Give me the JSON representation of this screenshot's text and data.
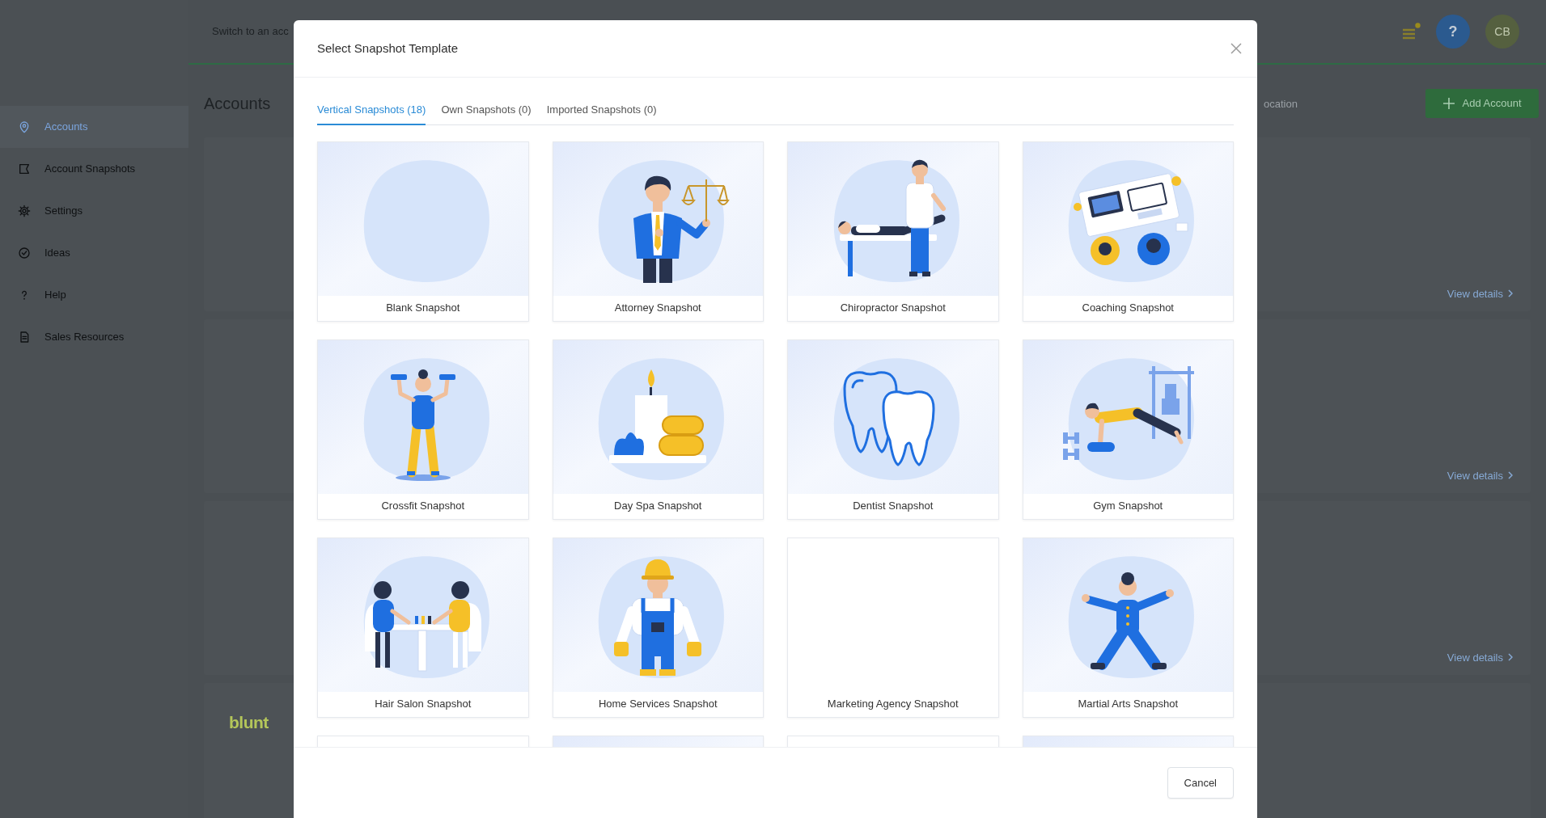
{
  "sidebar": {
    "items": [
      {
        "label": "Accounts",
        "selected": true
      },
      {
        "label": "Account Snapshots",
        "selected": false
      },
      {
        "label": "Settings",
        "selected": false
      },
      {
        "label": "Ideas",
        "selected": false
      },
      {
        "label": "Help",
        "selected": false
      },
      {
        "label": "Sales Resources",
        "selected": false
      }
    ]
  },
  "top_bar": {
    "switch_account_text": "Switch to an acc",
    "help_button": "?",
    "avatar": "CB"
  },
  "page": {
    "title": "Accounts",
    "search": {
      "placeholder": "ocation"
    },
    "add_button": "Add Account",
    "accounts": [
      {
        "link": "View details"
      },
      {
        "link": "View details"
      },
      {
        "link": "View details"
      },
      {
        "logo": "blunt"
      }
    ]
  },
  "modal": {
    "title": "Select Snapshot Template",
    "tabs": [
      {
        "label": "Vertical Snapshots (18)",
        "selected": true
      },
      {
        "label": "Own Snapshots (0)",
        "selected": false
      },
      {
        "label": "Imported Snapshots (0)",
        "selected": false
      }
    ],
    "templates": [
      {
        "label": "Blank Snapshot",
        "has_preview": true
      },
      {
        "label": "Attorney Snapshot",
        "has_preview": true
      },
      {
        "label": "Chiropractor Snapshot",
        "has_preview": true
      },
      {
        "label": "Coaching Snapshot",
        "has_preview": true
      },
      {
        "label": "Crossfit Snapshot",
        "has_preview": true
      },
      {
        "label": "Day Spa Snapshot",
        "has_preview": true
      },
      {
        "label": "Dentist Snapshot",
        "has_preview": true
      },
      {
        "label": "Gym Snapshot",
        "has_preview": true
      },
      {
        "label": "Hair Salon Snapshot",
        "has_preview": true
      },
      {
        "label": "Home Services Snapshot",
        "has_preview": true
      },
      {
        "label": "Marketing Agency Snapshot",
        "has_preview": false
      },
      {
        "label": "Martial Arts Snapshot",
        "has_preview": true
      },
      {
        "has_preview": false
      },
      {
        "has_preview": true
      },
      {
        "has_preview": false
      },
      {
        "has_preview": true
      }
    ],
    "cancel_button": "Cancel"
  }
}
